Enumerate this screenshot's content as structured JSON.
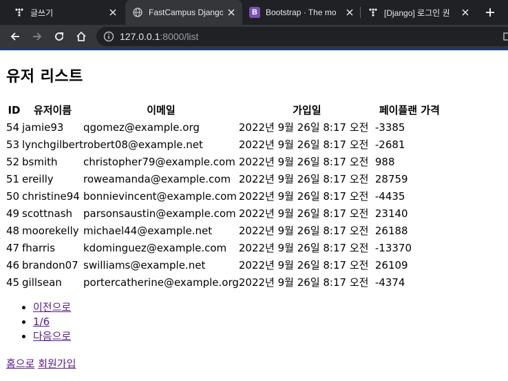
{
  "browser": {
    "tabs": [
      {
        "title": "글쓰기",
        "icon": "tistory-icon",
        "active": false
      },
      {
        "title": "FastCampus Django",
        "icon": "globe-icon",
        "active": true
      },
      {
        "title": "Bootstrap · The mo",
        "icon": "bootstrap-icon",
        "active": false
      },
      {
        "title": "[Django] 로그인 권",
        "icon": "tistory-icon",
        "active": false
      }
    ],
    "url_host": "127.0.0.1",
    "url_path": ":8000/list",
    "colors": {
      "tabstrip": "#202124",
      "toolbar": "#35363a",
      "bootstrap": "#7952b3"
    }
  },
  "page": {
    "title": "유저 리스트",
    "columns": [
      "ID",
      "유저이름",
      "이메일",
      "가입일",
      "페이플랜 가격"
    ],
    "rows": [
      [
        "54",
        "jamie93",
        "qgomez@example.org",
        "2022년 9월 26일 8:17 오전",
        "-3385"
      ],
      [
        "53",
        "lynchgilbert",
        "robert08@example.net",
        "2022년 9월 26일 8:17 오전",
        "-2681"
      ],
      [
        "52",
        "bsmith",
        "christopher79@example.com",
        "2022년 9월 26일 8:17 오전",
        "988"
      ],
      [
        "51",
        "ereilly",
        "roweamanda@example.com",
        "2022년 9월 26일 8:17 오전",
        "28759"
      ],
      [
        "50",
        "christine94",
        "bonnievincent@example.com",
        "2022년 9월 26일 8:17 오전",
        "-4435"
      ],
      [
        "49",
        "scottnash",
        "parsonsaustin@example.com",
        "2022년 9월 26일 8:17 오전",
        "23140"
      ],
      [
        "48",
        "moorekelly",
        "michael44@example.net",
        "2022년 9월 26일 8:17 오전",
        "26188"
      ],
      [
        "47",
        "fharris",
        "kdominguez@example.com",
        "2022년 9월 26일 8:17 오전",
        "-13370"
      ],
      [
        "46",
        "brandon07",
        "swilliams@example.net",
        "2022년 9월 26일 8:17 오전",
        "26109"
      ],
      [
        "45",
        "gillsean",
        "portercatherine@example.org",
        "2022년 9월 26일 8:17 오전",
        "-4374"
      ]
    ],
    "pagination": {
      "prev": "이전으로",
      "current": "1/6",
      "next": "다음으로"
    },
    "footer": {
      "home": "홈으로",
      "signup": "회원가입"
    }
  }
}
